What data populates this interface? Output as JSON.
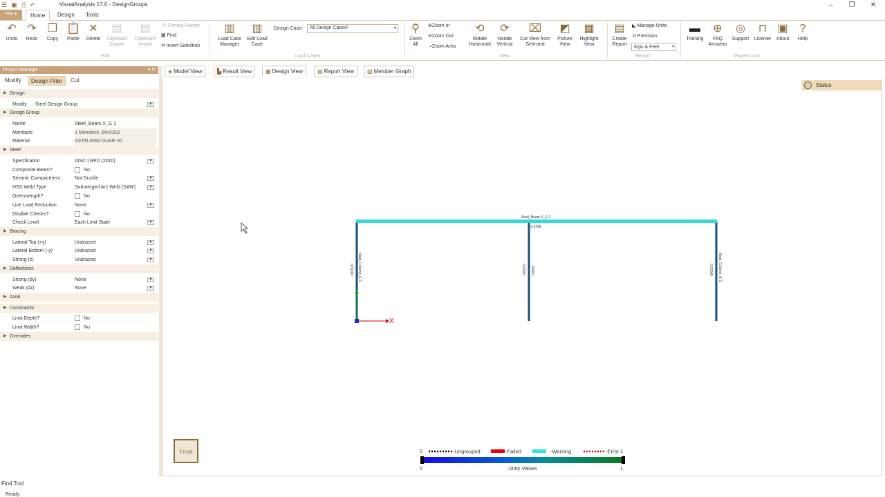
{
  "app": {
    "title": "VisualAnalysis 17.0 - DesignGroups",
    "quick_access_icons": [
      "menu-icon",
      "save-icon",
      "print-icon",
      "undo-icon"
    ]
  },
  "tabs": {
    "file": "File ▾",
    "items": [
      "Home",
      "Design",
      "Tools"
    ],
    "active": "Home"
  },
  "ribbon": {
    "undo": "Undo",
    "redo": "Redo",
    "copy": "Copy",
    "paste": "Paste",
    "delete": "Delete",
    "clipboard_export": "Clipboard Export",
    "clipboard_import": "Clipboard Import",
    "format_painter": "Format Painter",
    "find": "Find",
    "invert_selection": "Invert Selection",
    "group_edit": "Edit",
    "load_case_manager": "Load Case Manager",
    "edit_load_case": "Edit Load Case",
    "design_case_label": "Design Case:",
    "design_case_value": "All Design Cases!",
    "group_load_cases": "Load Cases",
    "zoom_all": "Zoom All",
    "zoom_in": "Zoom In",
    "zoom_out": "Zoom Out",
    "zoom_area": "Zoom Area",
    "rotate_horizontal": "Rotate Horizontal",
    "rotate_vertical": "Rotate Vertical",
    "cut_view": "Cut View from Selected",
    "picture_view": "Picture View",
    "highlight_view": "Highlight View",
    "group_view": "View",
    "create_report": "Create Report",
    "manage_units": "Manage Units",
    "precision": "Precision",
    "units_value": "Kips & Feet",
    "group_report": "Report",
    "training": "Training",
    "faq": "FAQ Answers",
    "support": "Support",
    "license": "License",
    "about": "About",
    "help": "Help",
    "group_iesweb": "iesweb.com"
  },
  "project_manager": {
    "title": "Project Manager",
    "tabs": [
      "Modify",
      "Design Filter",
      "Cut"
    ],
    "active_tab": "Design Filter",
    "rows": [
      {
        "type": "cat",
        "label": "Design"
      },
      {
        "type": "prop",
        "label": "Modify",
        "value": "Steel Design Group",
        "dd": true,
        "short": true
      },
      {
        "type": "cat",
        "label": "Design Group"
      },
      {
        "type": "prop",
        "label": "Name",
        "value": "Steel_Beam X_G 1"
      },
      {
        "type": "prop",
        "label": "Members",
        "value": "1 Members: BmX001",
        "italic": true
      },
      {
        "type": "prop",
        "label": "Material",
        "value": "ASTM A992 Grade 50",
        "italic": true
      },
      {
        "type": "cat",
        "label": "Steel"
      },
      {
        "type": "prop",
        "label": "Specification",
        "value": "AISC LRFD (2010)",
        "dd": true
      },
      {
        "type": "chk",
        "label": "Composite Beam?",
        "value": "No"
      },
      {
        "type": "prop",
        "label": "Seismic Compactness",
        "value": "Not Ductile",
        "dd": true
      },
      {
        "type": "prop",
        "label": "HSS Weld Type",
        "value": "Submerged Arc Weld (SAW)",
        "dd": true
      },
      {
        "type": "chk",
        "label": "Overstrength?",
        "value": "No"
      },
      {
        "type": "prop",
        "label": "Live Load Reduction",
        "value": "None",
        "dd": true
      },
      {
        "type": "chk",
        "label": "Disable Checks?",
        "value": "No"
      },
      {
        "type": "prop",
        "label": "Check Level",
        "value": "Each Limit State",
        "dd": true
      },
      {
        "type": "cat",
        "label": "Bracing"
      },
      {
        "type": "prop",
        "label": "Lateral Top (+y)",
        "value": "Unbraced",
        "dd": true
      },
      {
        "type": "prop",
        "label": "Lateral Bottom (-y)",
        "value": "Unbraced",
        "dd": true
      },
      {
        "type": "prop",
        "label": "Strong (z)",
        "value": "Unbraced",
        "dd": true
      },
      {
        "type": "cat",
        "label": "Deflections"
      },
      {
        "type": "prop",
        "label": "Strong (dy)",
        "value": "None",
        "dd": true
      },
      {
        "type": "prop",
        "label": "Weak (dz)",
        "value": "None",
        "dd": true
      },
      {
        "type": "cat",
        "label": "Axial"
      },
      {
        "type": "cat",
        "label": "Constraints"
      },
      {
        "type": "chk",
        "label": "Limit Depth?",
        "value": "No"
      },
      {
        "type": "chk",
        "label": "Limit Width?",
        "value": "No"
      },
      {
        "type": "cat",
        "label": "Overrides"
      }
    ]
  },
  "view_tabs": [
    "Model View",
    "Result View",
    "Design View",
    "Report View",
    "Member Graph"
  ],
  "active_view": "Design View",
  "status_panel": "Status",
  "model": {
    "beam_label": "Steel_Beam X_G 1",
    "beam_unity": "0.2708",
    "left_col_label": "Steel_Column_G 1",
    "left_col_unity": "0.61081",
    "mid_col_label": "D0001",
    "mid_col_unity": "0.69067",
    "right_col_label": "Steel_Column_G 1",
    "right_col_unity": "0.72065",
    "axis_x": "X",
    "beam_color": "#30d8e0",
    "column_color": "#1a4f7a"
  },
  "legend": {
    "ungrouped": "-Ungrouped",
    "failed": "-Failed",
    "warning": "-Warning",
    "error": "-Error",
    "min": "0",
    "max": "1",
    "min_bottom": "0",
    "max_bottom": "1",
    "caption": "Unity Values"
  },
  "front_button": "Front",
  "bottom": {
    "find_tool": "Find Tool",
    "status": "Ready"
  }
}
